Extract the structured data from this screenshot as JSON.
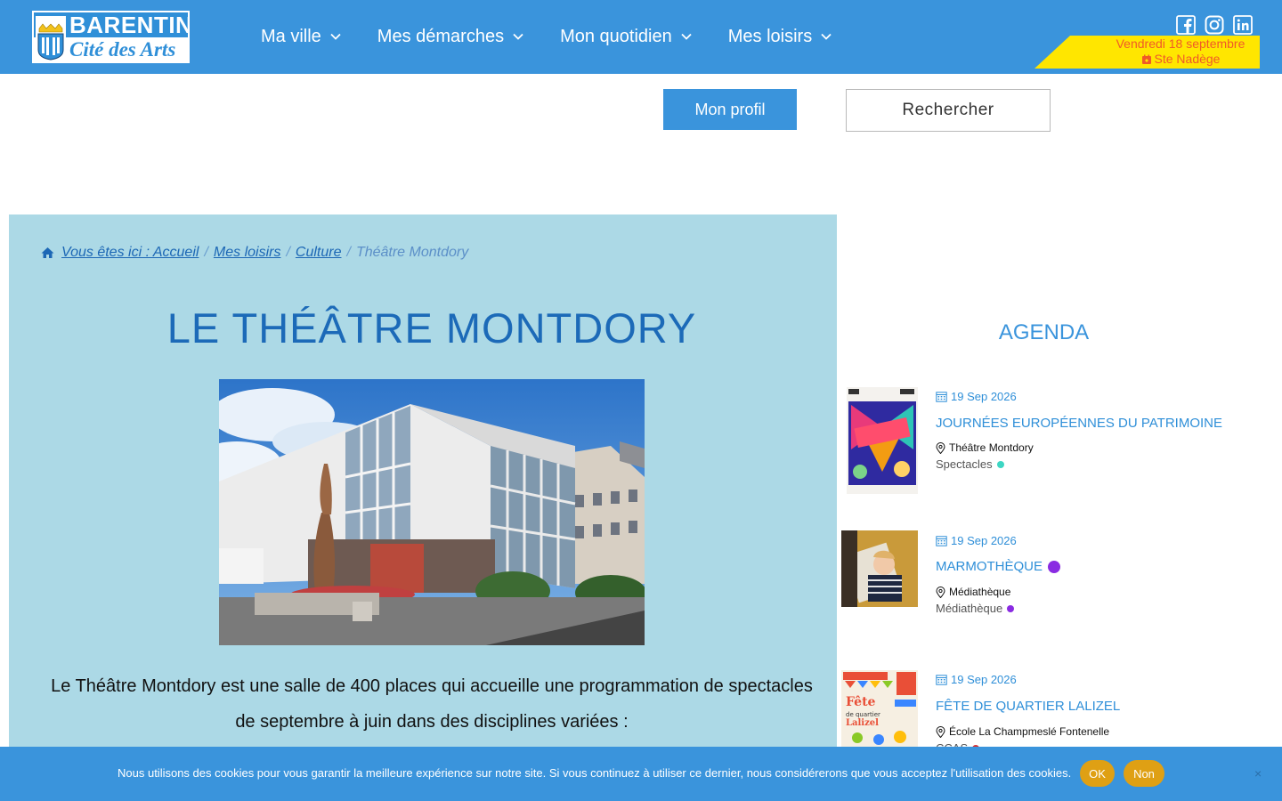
{
  "header": {
    "logo_name": "BARENTIN",
    "logo_sub": "Cité des Arts",
    "nav": [
      {
        "label": "Ma ville"
      },
      {
        "label": "Mes démarches"
      },
      {
        "label": "Mon quotidien"
      },
      {
        "label": "Mes loisirs"
      }
    ],
    "social": [
      "facebook-icon",
      "instagram-icon",
      "linkedin-icon"
    ],
    "date_line": "Vendredi 18 septembre",
    "saint_line": "Ste Nadège",
    "colors": {
      "header": "#3a94dc",
      "banner": "#ffe600",
      "banner_text": "#f05a28"
    }
  },
  "actions": {
    "profile_label": "Mon profil",
    "search_label": "Rechercher"
  },
  "breadcrumb": {
    "home": "Vous êtes ici : Accueil",
    "items": [
      "Mes loisirs",
      "Culture"
    ],
    "current": "Théâtre Montdory"
  },
  "main": {
    "title": "LE THÉÂTRE MONTDORY",
    "intro_line1": "Le Théâtre Montdory est une salle de 400 places qui accueille une programmation de spectacles",
    "intro_line2": "de septembre à juin dans des disciplines variées :"
  },
  "agenda": {
    "title": "AGENDA",
    "events": [
      {
        "date": "19 Sep 2026",
        "title": "JOURNÉES EUROPÉENNES DU PATRIMOINE",
        "location": "Théâtre Montdory",
        "category": "Spectacles",
        "category_color": "#3dd6c3",
        "title_dot": ""
      },
      {
        "date": "19 Sep 2026",
        "title": "MARMOTHÈQUE",
        "location": "Médiathèque",
        "category": "Médiathèque",
        "category_color": "#8a2be2",
        "title_dot": "#8a2be2"
      },
      {
        "date": "19 Sep 2026",
        "title": "FÊTE DE QUARTIER LALIZEL",
        "location": "École La Champmeslé Fontenelle",
        "category": "CCAS",
        "category_color": "#d93030",
        "title_dot": ""
      }
    ]
  },
  "cookie": {
    "text": "Nous utilisons des cookies pour vous garantir la meilleure expérience sur notre site. Si vous continuez à utiliser ce dernier, nous considérerons que vous acceptez l'utilisation des cookies.",
    "ok": "OK",
    "no": "Non",
    "close": "×"
  }
}
